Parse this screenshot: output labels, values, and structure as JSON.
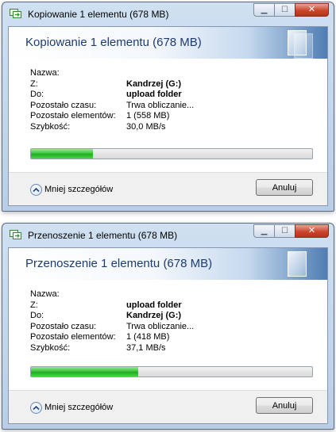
{
  "dialogs": [
    {
      "window_title": "Kopiowanie 1 elementu (678 MB)",
      "heading": "Kopiowanie 1 elementu (678 MB)",
      "fields": [
        {
          "label": "Nazwa:",
          "value": ""
        },
        {
          "label": "Z:",
          "value": "Kandrzej (G:)"
        },
        {
          "label": "Do:",
          "value": "upload folder"
        },
        {
          "label": "Pozostało czasu:",
          "value": "Trwa obliczanie..."
        },
        {
          "label": "Pozostało elementów:",
          "value": "1 (558 MB)"
        },
        {
          "label": "Szybkość:",
          "value": "30,0 MB/s"
        }
      ],
      "progress_fraction": 0.22,
      "less_details_label": "Mniej szczegółów",
      "cancel_label": "Anuluj"
    },
    {
      "window_title": "Przenoszenie 1 elementu (678 MB)",
      "heading": "Przenoszenie 1 elementu (678 MB)",
      "fields": [
        {
          "label": "Nazwa:",
          "value": ""
        },
        {
          "label": "Z:",
          "value": "upload folder"
        },
        {
          "label": "Do:",
          "value": "Kandrzej (G:)"
        },
        {
          "label": "Pozostało czasu:",
          "value": "Trwa obliczanie..."
        },
        {
          "label": "Pozostało elementów:",
          "value": "1 (418 MB)"
        },
        {
          "label": "Szybkość:",
          "value": "37,1 MB/s"
        }
      ],
      "progress_fraction": 0.38,
      "less_details_label": "Mniej szczegółów",
      "cancel_label": "Anuluj"
    }
  ],
  "colors": {
    "progress_green": "#3cc43c",
    "heading_blue": "#1e3b6e",
    "close_red": "#c9452b"
  },
  "icons": {
    "title": "copy-files-icon",
    "caption_min": "minimize-icon",
    "caption_max": "maximize-icon",
    "caption_close": "close-icon",
    "less_details": "chevron-up-icon"
  }
}
